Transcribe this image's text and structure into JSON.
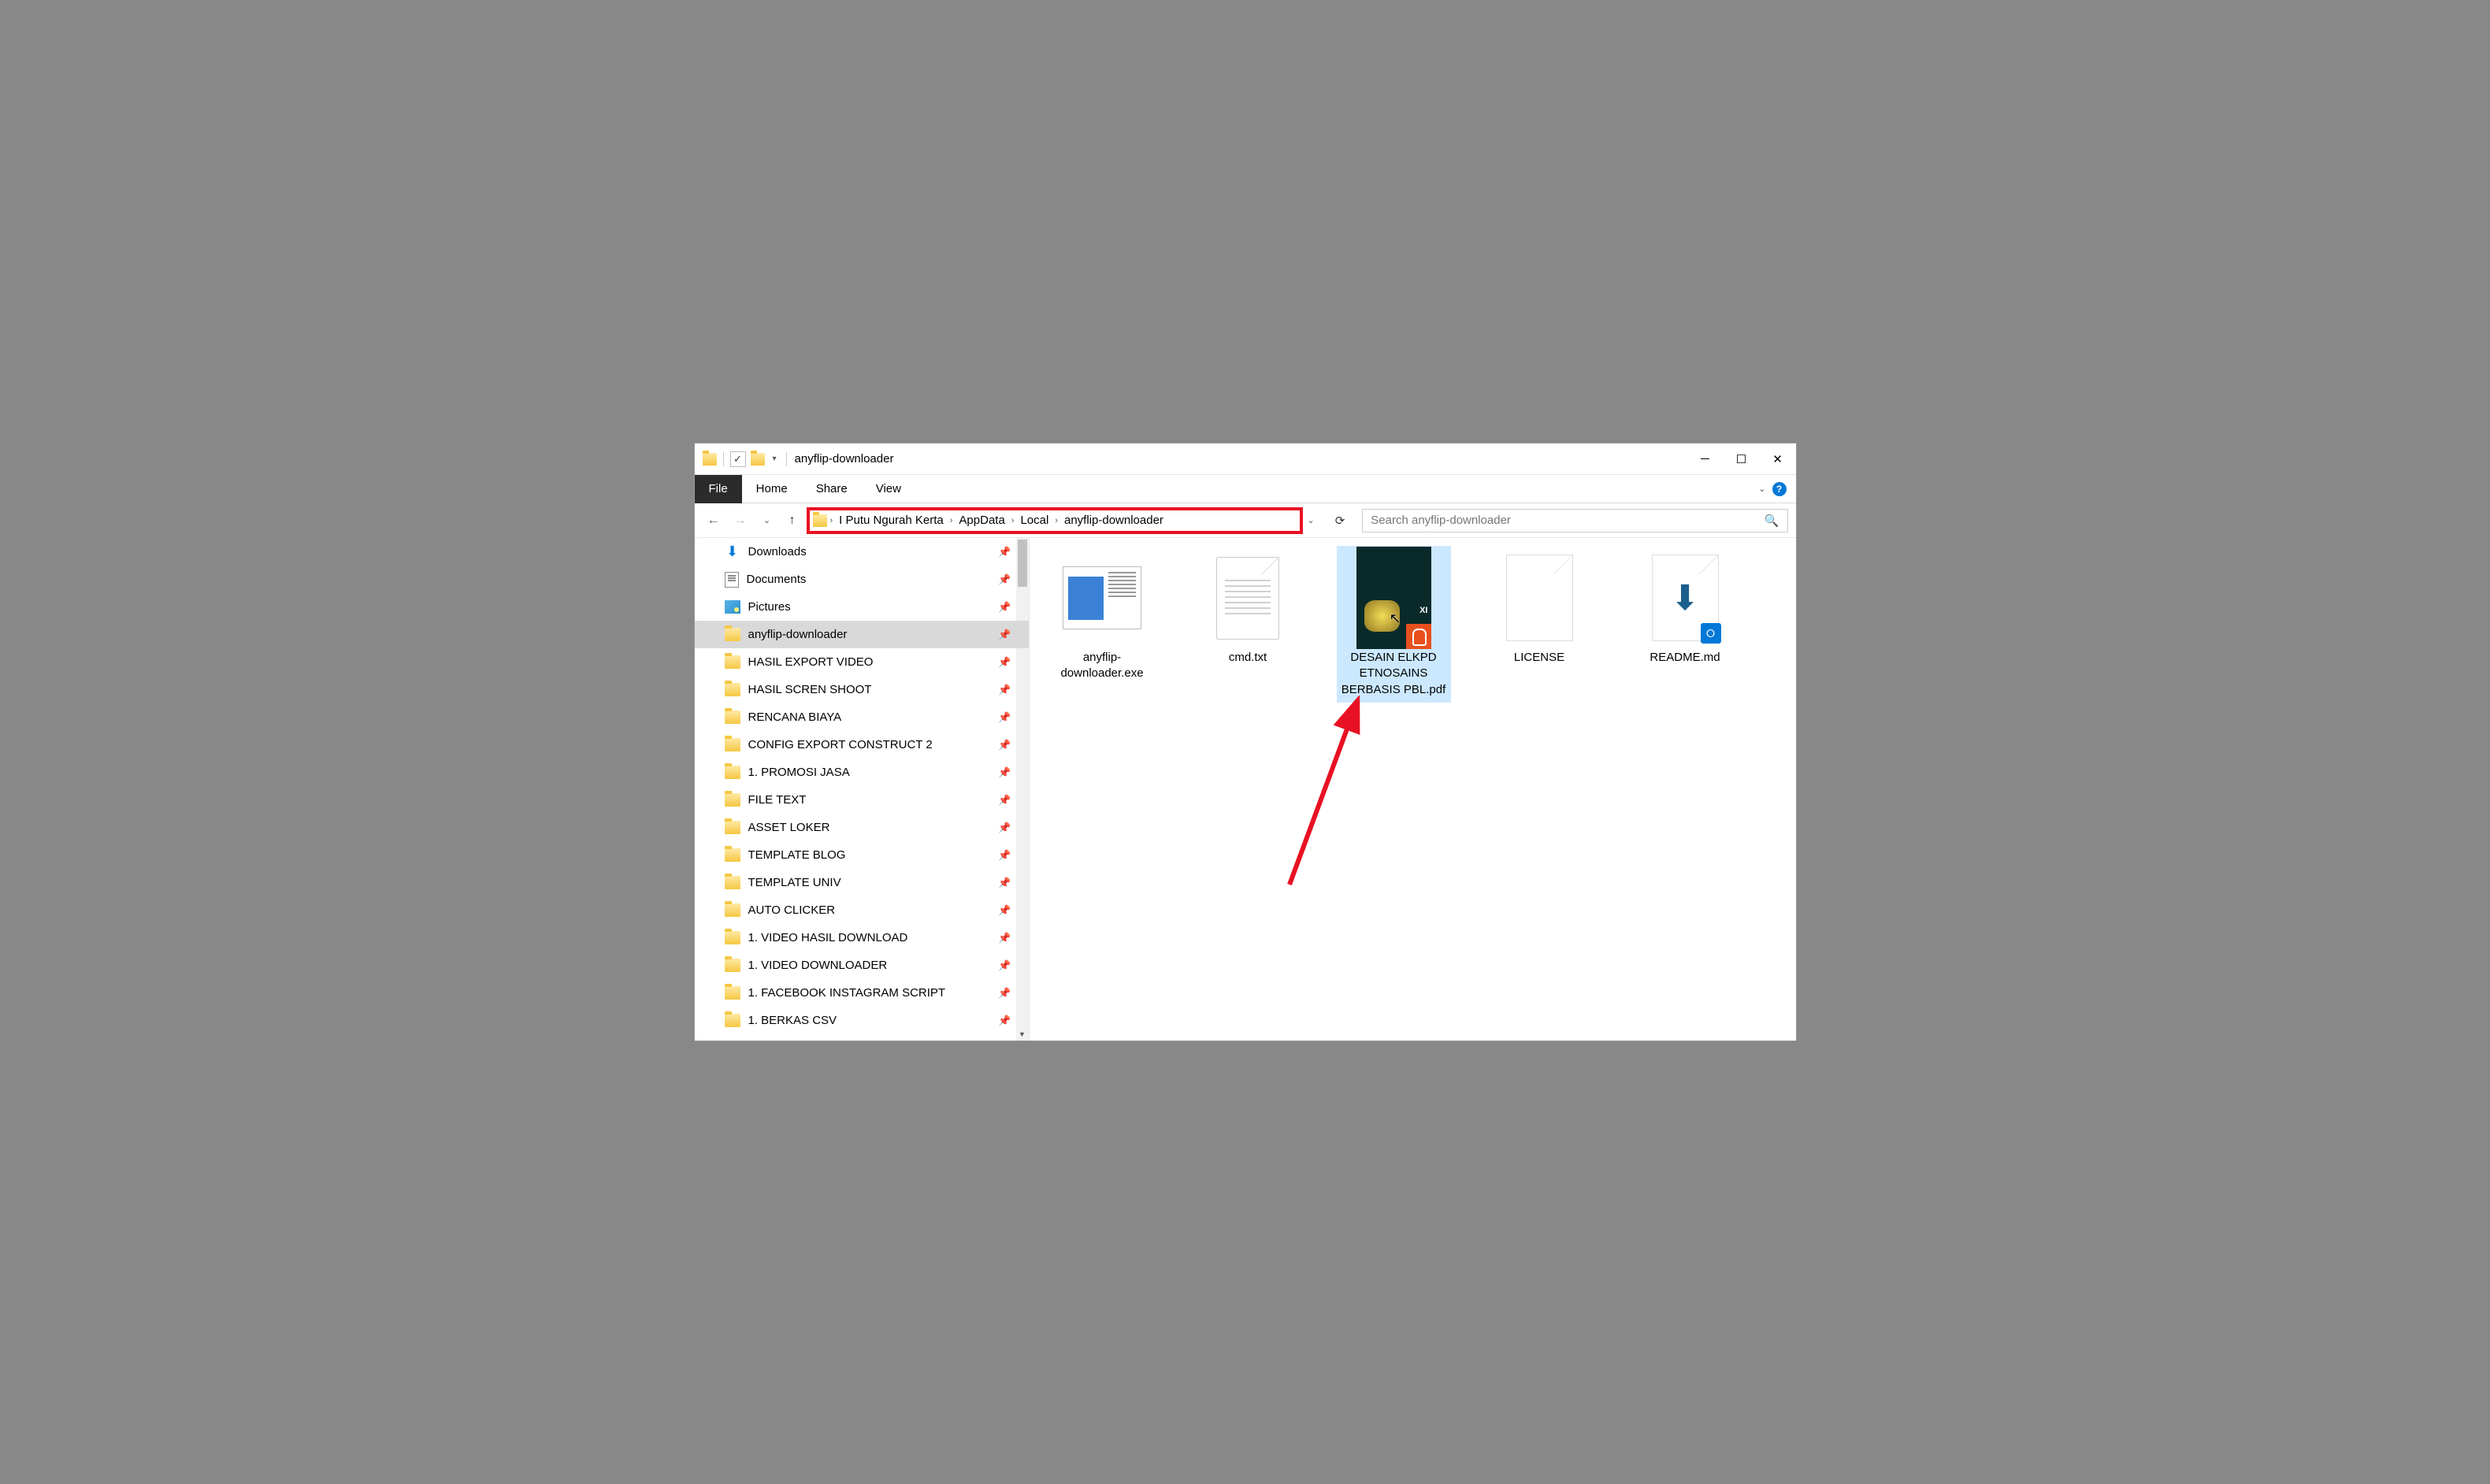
{
  "window_title": "anyflip-downloader",
  "ribbon": {
    "file": "File",
    "tabs": [
      "Home",
      "Share",
      "View"
    ]
  },
  "breadcrumbs": [
    "I Putu Ngurah Kerta",
    "AppData",
    "Local",
    "anyflip-downloader"
  ],
  "search_placeholder": "Search anyflip-downloader",
  "sidebar": [
    {
      "name": "Downloads",
      "icon": "download",
      "pinned": true
    },
    {
      "name": "Documents",
      "icon": "document",
      "pinned": true
    },
    {
      "name": "Pictures",
      "icon": "picture",
      "pinned": true
    },
    {
      "name": "anyflip-downloader",
      "icon": "folder",
      "pinned": true,
      "selected": true
    },
    {
      "name": "HASIL EXPORT VIDEO",
      "icon": "folder",
      "pinned": true
    },
    {
      "name": "HASIL SCREN SHOOT",
      "icon": "folder",
      "pinned": true
    },
    {
      "name": "RENCANA BIAYA",
      "icon": "folder",
      "pinned": true
    },
    {
      "name": "CONFIG EXPORT CONSTRUCT 2",
      "icon": "folder",
      "pinned": true
    },
    {
      "name": "1. PROMOSI JASA",
      "icon": "folder",
      "pinned": true
    },
    {
      "name": "FILE TEXT",
      "icon": "folder",
      "pinned": true
    },
    {
      "name": "ASSET LOKER",
      "icon": "folder",
      "pinned": true
    },
    {
      "name": "TEMPLATE BLOG",
      "icon": "folder",
      "pinned": true
    },
    {
      "name": "TEMPLATE UNIV",
      "icon": "folder",
      "pinned": true
    },
    {
      "name": "AUTO CLICKER",
      "icon": "folder",
      "pinned": true
    },
    {
      "name": "1. VIDEO HASIL DOWNLOAD",
      "icon": "folder",
      "pinned": true
    },
    {
      "name": "1. VIDEO DOWNLOADER",
      "icon": "folder",
      "pinned": true
    },
    {
      "name": "1. FACEBOOK INSTAGRAM SCRIPT",
      "icon": "folder",
      "pinned": true
    },
    {
      "name": "1. BERKAS CSV",
      "icon": "folder",
      "pinned": true
    }
  ],
  "files": [
    {
      "name": "anyflip-downloader.exe",
      "thumb": "exe"
    },
    {
      "name": "cmd.txt",
      "thumb": "txt"
    },
    {
      "name": "DESAIN ELKPD ETNOSAINS BERBASIS PBL.pdf",
      "thumb": "pdf",
      "selected": true
    },
    {
      "name": "LICENSE",
      "thumb": "blank"
    },
    {
      "name": "README.md",
      "thumb": "md"
    }
  ]
}
